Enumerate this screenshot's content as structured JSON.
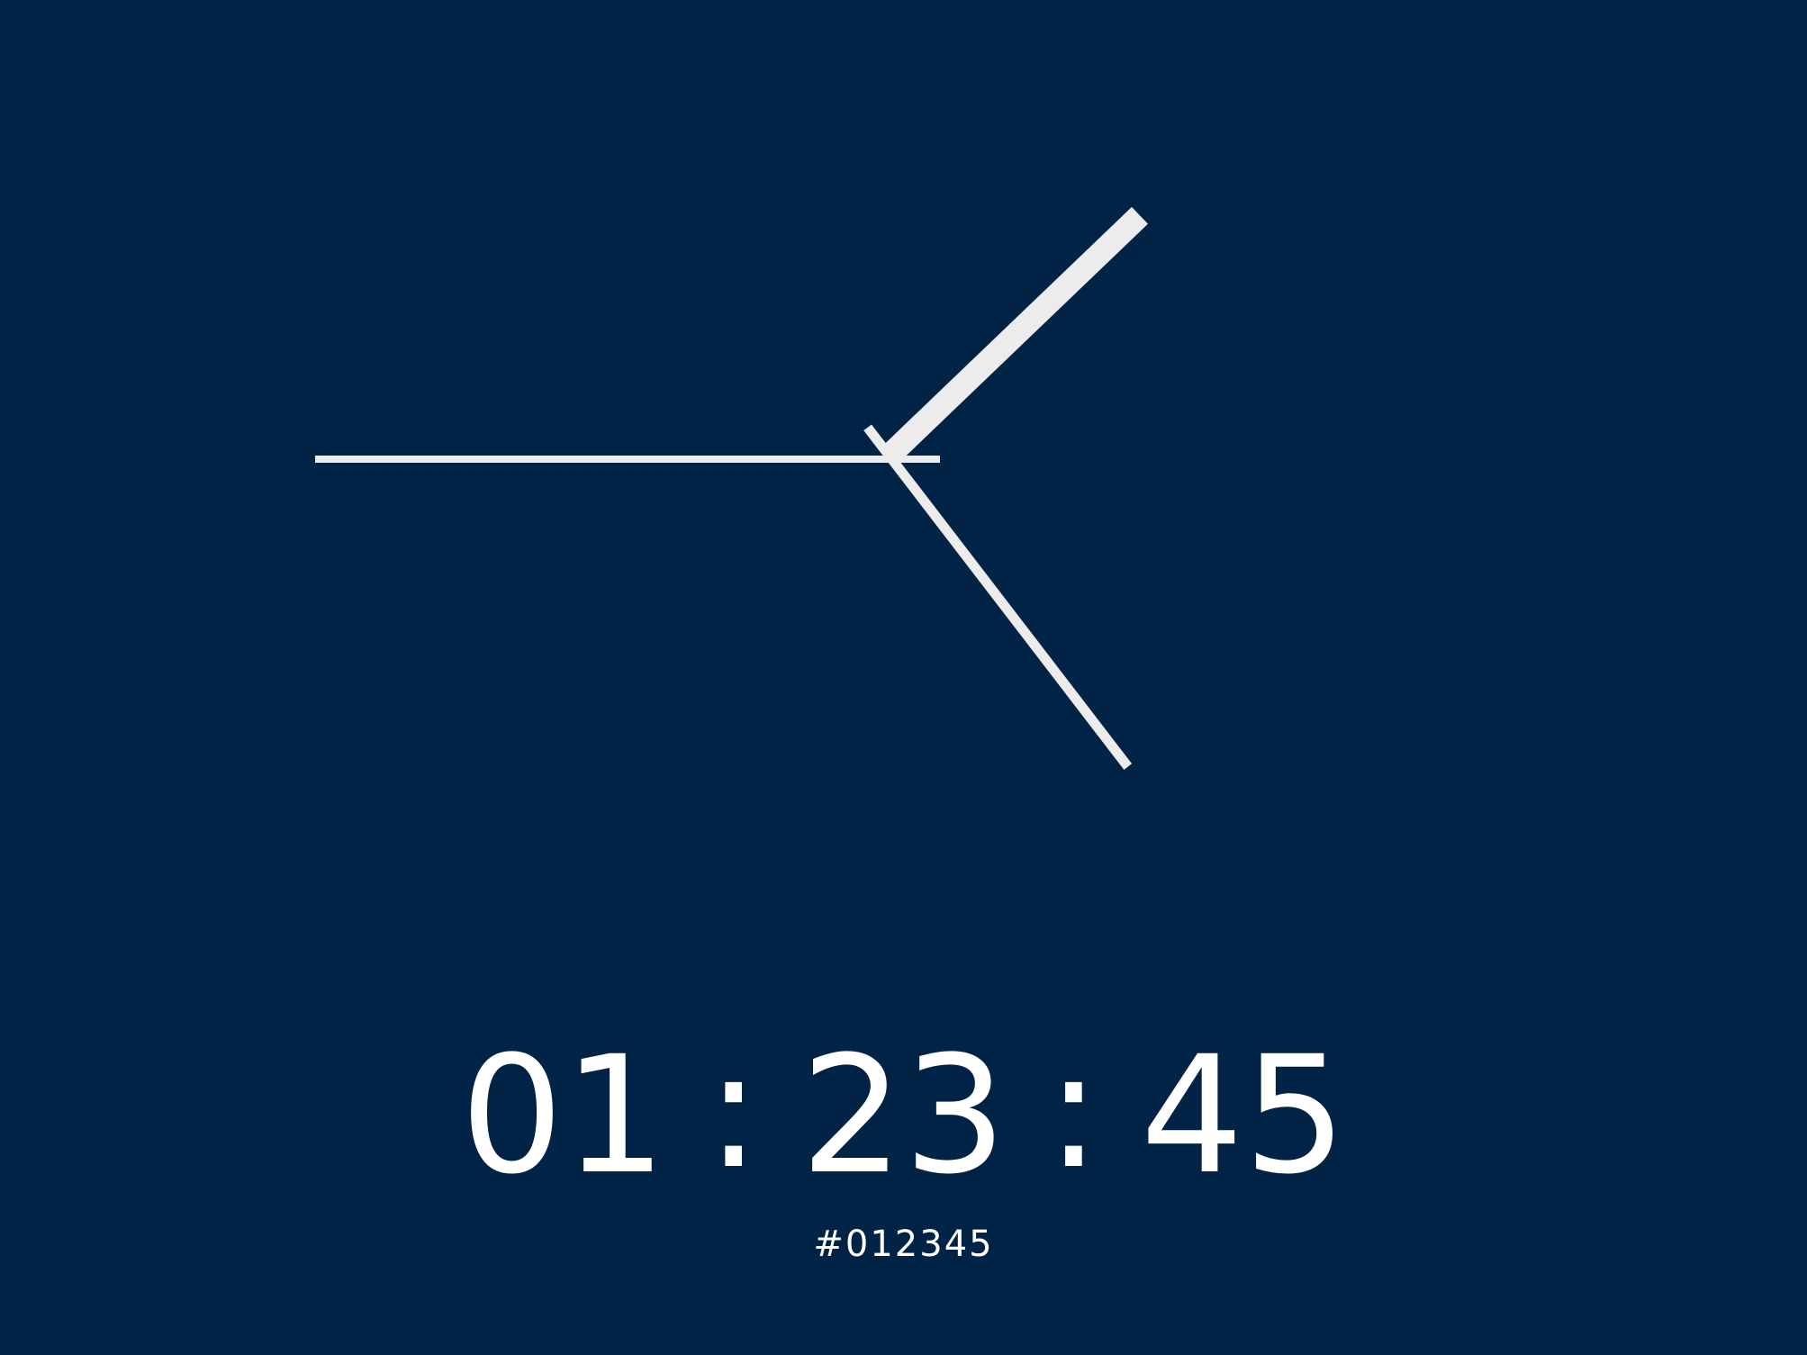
{
  "clock": {
    "hours": "01",
    "minutes": "23",
    "seconds": "45",
    "separator": ":",
    "hex_color": "#012345",
    "hand_color": "#ececec",
    "background_color": "#012345"
  }
}
